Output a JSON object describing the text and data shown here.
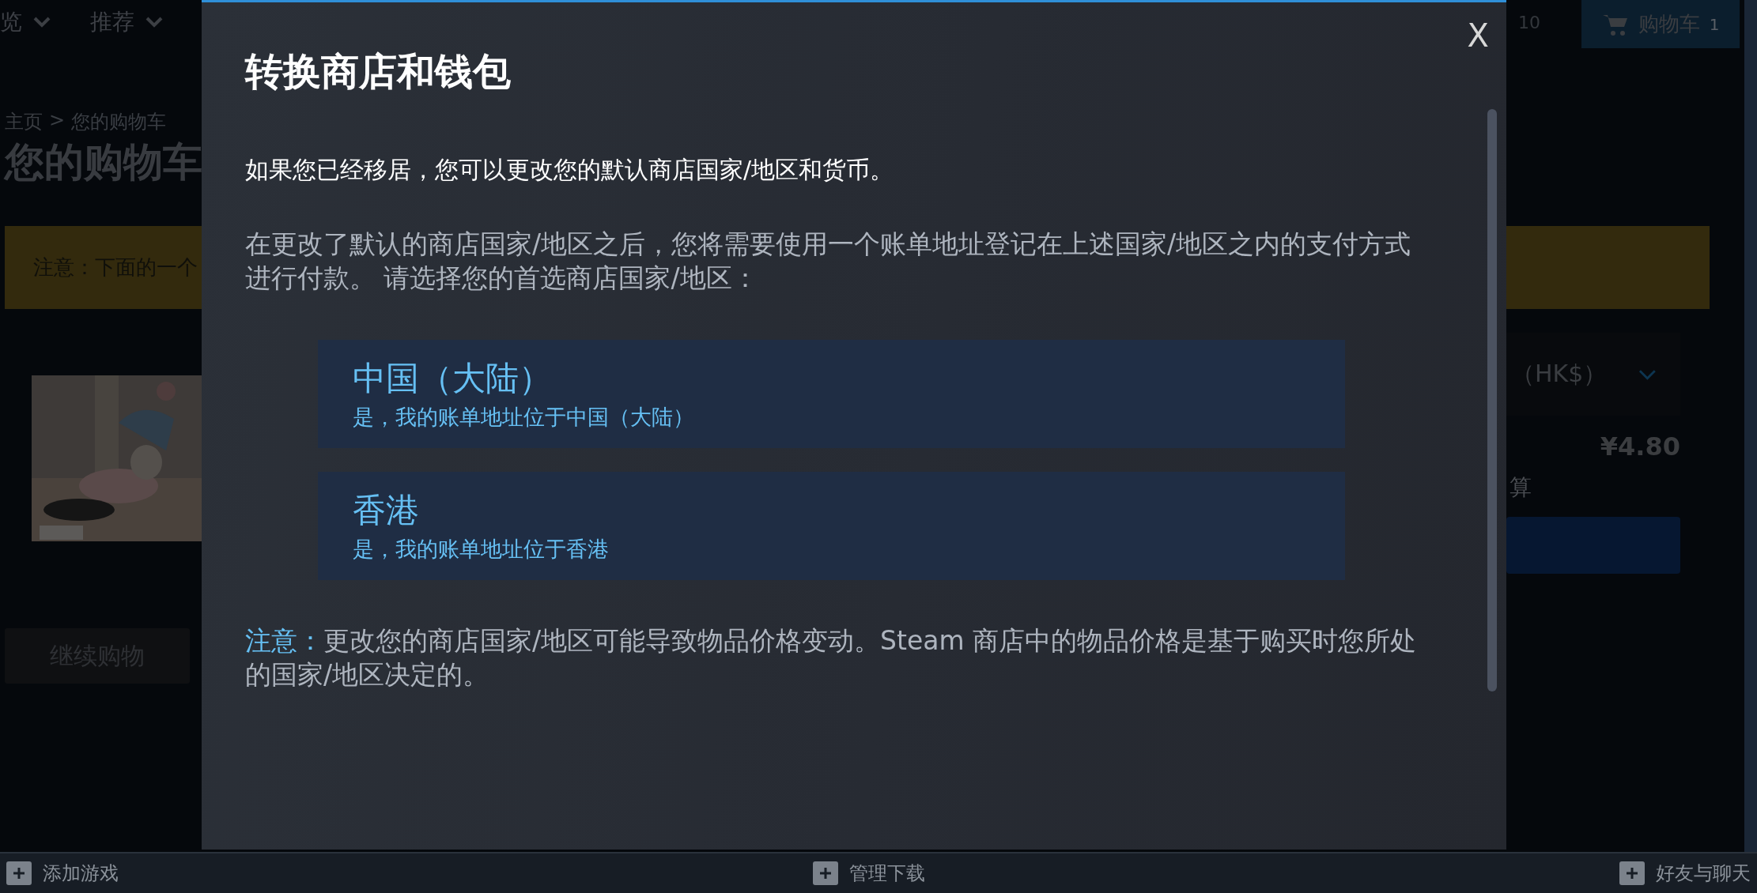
{
  "nav": {
    "menus": [
      {
        "label": "览"
      },
      {
        "label": "推荐"
      }
    ],
    "counter": "10",
    "cart_button": {
      "label": "购物车",
      "count": "1"
    }
  },
  "page": {
    "breadcrumb": {
      "home": "主页",
      "separator": ">",
      "current": "您的购物车"
    },
    "title": "您的购物车",
    "notice": "注意：下面的一个",
    "continue_button": "继续购物",
    "currency_select": "（HK$）",
    "price": "¥4.80",
    "checkout_label": "算"
  },
  "dialog": {
    "title": "转换商店和钱包",
    "close": "X",
    "intro": "如果您已经移居，您可以更改您的默认商店国家/地区和货币。",
    "instructions": "在更改了默认的商店国家/地区之后，您将需要使用一个账单地址登记在上述国家/地区之内的支付方式进行付款。 请选择您的首选商店国家/地区：",
    "options": [
      {
        "name": "中国（大陆）",
        "confirmation": "是，我的账单地址位于中国（大陆）"
      },
      {
        "name": "香港",
        "confirmation": "是，我的账单地址位于香港"
      }
    ],
    "note": {
      "label": "注意：",
      "text": "更改您的商店国家/地区可能导致物品价格变动。Steam 商店中的物品价格是基于购买时您所处的国家/地区决定的。"
    }
  },
  "bottom_bar": {
    "items": [
      "添加游戏",
      "管理下载",
      "好友与聊天"
    ]
  }
}
